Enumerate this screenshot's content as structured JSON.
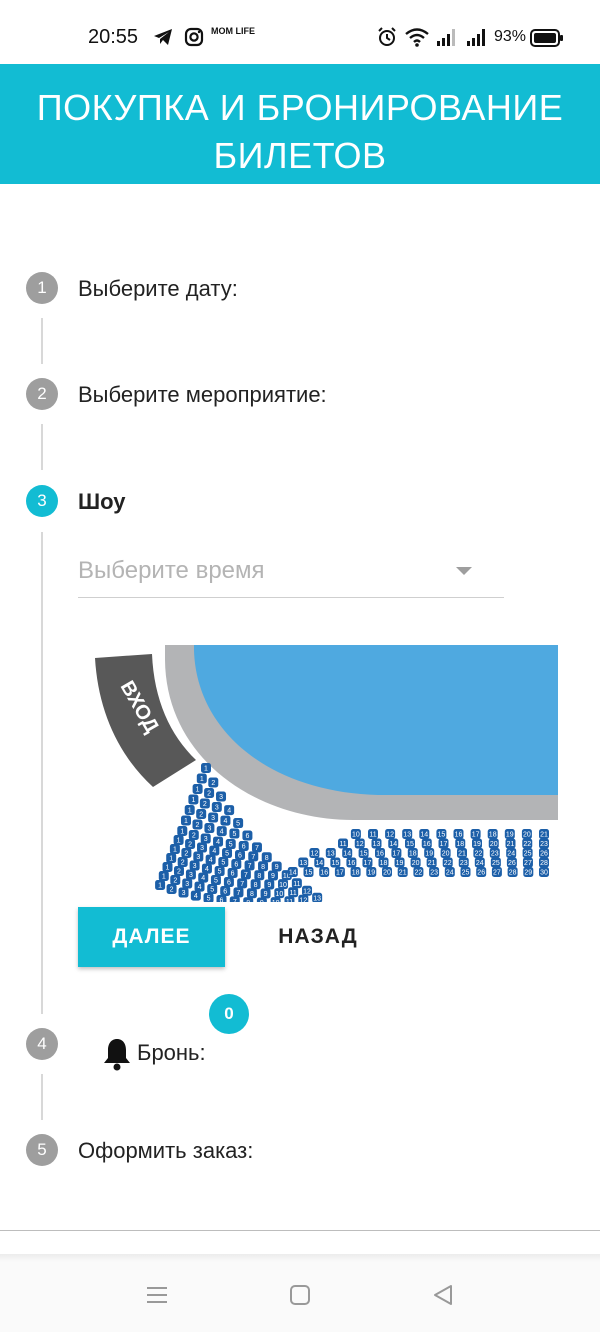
{
  "status_bar": {
    "time": "20:55",
    "battery": "93%",
    "icons": [
      "telegram-icon",
      "instagram-icon",
      "mom-life-icon",
      "alarm-icon",
      "wifi-icon",
      "signal-icon",
      "signal-icon",
      "battery-icon"
    ],
    "mom_life_text": "MOM LIFE"
  },
  "header": {
    "title": "ПОКУПКА И БРОНИРОВАНИЕ БИЛЕТОВ"
  },
  "steps": [
    {
      "number": "1",
      "label": "Выберите дату:"
    },
    {
      "number": "2",
      "label": "Выберите мероприятие:"
    },
    {
      "number": "3",
      "label": "Шоу"
    },
    {
      "number": "4",
      "label": "Бронь:"
    },
    {
      "number": "5",
      "label": "Оформить заказ:"
    }
  ],
  "time_select": {
    "placeholder": "Выберите время"
  },
  "seat_map": {
    "entrance_label": "ВХОД",
    "curve_rows": [
      {
        "seats": [
          "1"
        ]
      },
      {
        "seats": [
          "1",
          "2"
        ]
      },
      {
        "seats": [
          "1",
          "2",
          "3"
        ]
      },
      {
        "seats": [
          "1",
          "2",
          "3",
          "4"
        ]
      },
      {
        "seats": [
          "1",
          "2",
          "3",
          "4",
          "5"
        ]
      },
      {
        "seats": [
          "1",
          "2",
          "3",
          "4",
          "5",
          "6"
        ]
      },
      {
        "seats": [
          "1",
          "2",
          "3",
          "4",
          "5",
          "6",
          "7"
        ]
      },
      {
        "seats": [
          "1",
          "2",
          "3",
          "4",
          "5",
          "6",
          "7",
          "8"
        ]
      },
      {
        "seats": [
          "1",
          "2",
          "3",
          "4",
          "5",
          "6",
          "7",
          "8",
          "9"
        ]
      },
      {
        "seats": [
          "1",
          "2",
          "3",
          "4",
          "5",
          "6",
          "7",
          "8",
          "9",
          "10"
        ]
      },
      {
        "seats": [
          "1",
          "2",
          "3",
          "4",
          "5",
          "6",
          "7",
          "8",
          "9",
          "10",
          "11"
        ]
      },
      {
        "seats": [
          "1",
          "2",
          "3",
          "4",
          "5",
          "6",
          "7",
          "8",
          "9",
          "10",
          "11",
          "12"
        ]
      },
      {
        "seats": [
          "1",
          "2",
          "3",
          "4",
          "5",
          "6",
          "7",
          "8",
          "9",
          "10",
          "11",
          "12",
          "13"
        ]
      }
    ],
    "straight_rows": [
      {
        "seats": [
          "10",
          "11",
          "12",
          "13",
          "14",
          "15",
          "16",
          "17",
          "18",
          "19",
          "20",
          "21"
        ]
      },
      {
        "seats": [
          "11",
          "12",
          "13",
          "14",
          "15",
          "16",
          "17",
          "18",
          "19",
          "20",
          "21",
          "22",
          "23"
        ]
      },
      {
        "seats": [
          "12",
          "13",
          "14",
          "15",
          "16",
          "17",
          "18",
          "19",
          "20",
          "21",
          "22",
          "23",
          "24",
          "25",
          "26"
        ]
      },
      {
        "seats": [
          "13",
          "14",
          "15",
          "16",
          "17",
          "18",
          "19",
          "20",
          "21",
          "22",
          "23",
          "24",
          "25",
          "26",
          "27",
          "28"
        ]
      },
      {
        "seats": [
          "14",
          "15",
          "16",
          "17",
          "18",
          "19",
          "20",
          "21",
          "22",
          "23",
          "24",
          "25",
          "26",
          "27",
          "28",
          "29",
          "30"
        ]
      }
    ],
    "seat_color": "#1c5fa8",
    "pool_color": "#4fa9e0",
    "deck_color": "#b3b4b6",
    "entrance_color": "#585858"
  },
  "buttons": {
    "next": "ДАЛЕЕ",
    "back": "НАЗАД"
  },
  "booking": {
    "count": "0"
  },
  "accent_color": "#12bcd3"
}
